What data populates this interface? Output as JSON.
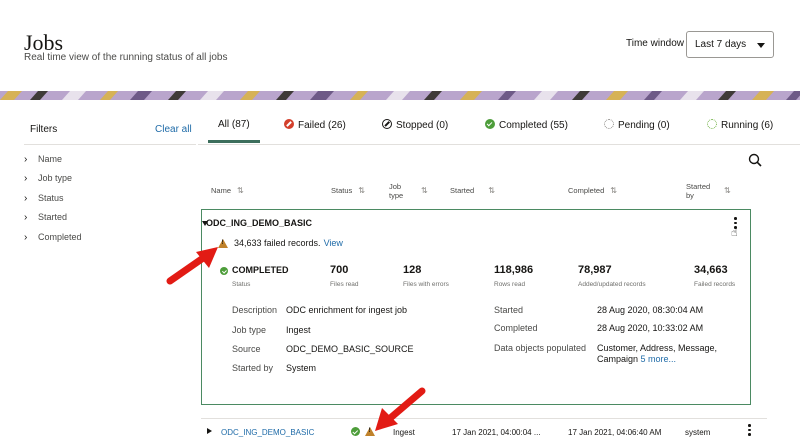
{
  "header": {
    "title": "Jobs",
    "subtitle": "Real time view of the running status of all jobs",
    "time_window_label": "Time window",
    "time_window_value": "Last 7 days"
  },
  "filters": {
    "title": "Filters",
    "clear_all": "Clear all",
    "items": [
      "Name",
      "Job type",
      "Status",
      "Started",
      "Completed"
    ]
  },
  "tabs": [
    {
      "label": "All (87)",
      "icon": "none",
      "active": true
    },
    {
      "label": "Failed (26)",
      "icon": "failed-icon"
    },
    {
      "label": "Stopped (0)",
      "icon": "stopped-icon"
    },
    {
      "label": "Completed (55)",
      "icon": "completed-icon"
    },
    {
      "label": "Pending (0)",
      "icon": "pending-icon"
    },
    {
      "label": "Running (6)",
      "icon": "running-icon"
    }
  ],
  "columns": {
    "name": "Name",
    "status": "Status",
    "job_type": "Job type",
    "started": "Started",
    "completed": "Completed",
    "started_by": "Started by"
  },
  "expanded_job": {
    "name": "ODC_ING_DEMO_BASIC",
    "failed_message": "34,633 failed records.",
    "view_link": "View",
    "status": "COMPLETED",
    "status_label": "Status",
    "stats": [
      {
        "value": "700",
        "label": "Files read"
      },
      {
        "value": "128",
        "label": "Files with errors"
      },
      {
        "value": "118,986",
        "label": "Rows read"
      },
      {
        "value": "78,987",
        "label": "Added/updated records"
      },
      {
        "value": "34,663",
        "label": "Failed records"
      }
    ],
    "details_left": [
      {
        "label": "Description",
        "value": "ODC enrichment for ingest job"
      },
      {
        "label": "Job type",
        "value": "Ingest"
      },
      {
        "label": "Source",
        "value": "ODC_DEMO_BASIC_SOURCE"
      },
      {
        "label": "Started by",
        "value": "System"
      }
    ],
    "details_right": {
      "started_label": "Started",
      "started_value": "28 Aug 2020, 08:30:04 AM",
      "completed_label": "Completed",
      "completed_value": "28 Aug 2020, 10:33:02 AM",
      "objects_label": "Data objects populated",
      "objects_value_line1": "Customer, Address, Message,",
      "objects_value_line2": "Campaign",
      "objects_more": "5 more..."
    }
  },
  "row": {
    "name": "ODC_ING_DEMO_BASIC",
    "job_type": "Ingest",
    "started": "17 Jan 2021, 04:00:04 ...",
    "completed": "17 Jan 2021, 04:06:40 AM",
    "started_by": "system"
  },
  "colors": {
    "accent_green": "#4b8a62",
    "link_blue": "#1f6ba8",
    "arrow_red": "#e21b14",
    "warning_orange": "#c0822b"
  }
}
